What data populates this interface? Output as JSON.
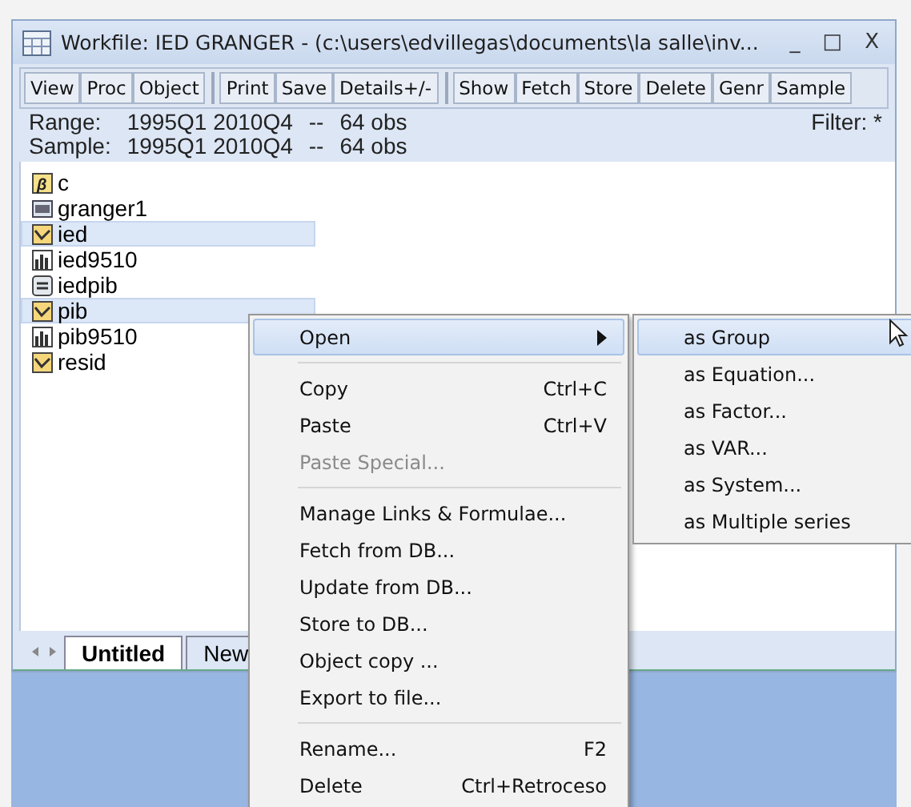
{
  "window": {
    "title": "Workfile: IED GRANGER - (c:\\users\\edvillegas\\documents\\la salle\\inv...",
    "controls": [
      "_",
      "□",
      "X"
    ]
  },
  "toolbar": [
    [
      "View",
      "Proc",
      "Object"
    ],
    [
      "Print",
      "Save",
      "Details+/-"
    ],
    [
      "Show",
      "Fetch",
      "Store",
      "Delete",
      "Genr",
      "Sample"
    ]
  ],
  "info": {
    "range_label": "Range:",
    "range": "1995Q1 2010Q4",
    "range_sep": "--",
    "range_obs": "64 obs",
    "sample_label": "Sample:",
    "sample": "1995Q1 2010Q4",
    "sample_sep": "--",
    "sample_obs": "64 obs",
    "filter": "Filter: *"
  },
  "objects": [
    {
      "name": "c",
      "kind": "coef",
      "icon_text": "β",
      "selected": false
    },
    {
      "name": "granger1",
      "kind": "var",
      "selected": false
    },
    {
      "name": "ied",
      "kind": "series",
      "selected": true
    },
    {
      "name": "ied9510",
      "kind": "graph",
      "selected": false
    },
    {
      "name": "iedpib",
      "kind": "equation",
      "selected": false
    },
    {
      "name": "pib",
      "kind": "series",
      "selected": true
    },
    {
      "name": "pib9510",
      "kind": "graph",
      "selected": false
    },
    {
      "name": "resid",
      "kind": "series",
      "selected": false
    }
  ],
  "tabs": [
    {
      "label": "Untitled",
      "selected": true
    },
    {
      "label": "New",
      "selected": false
    }
  ],
  "context_menu": [
    [
      {
        "label": "Open",
        "kind": "submenu",
        "selected": true,
        "disabled": false
      }
    ],
    [
      {
        "label": "Copy",
        "shortcut": "Ctrl+C",
        "selected": false,
        "disabled": false
      },
      {
        "label": "Paste",
        "shortcut": "Ctrl+V",
        "selected": false,
        "disabled": false
      },
      {
        "label": "Paste Special...",
        "selected": false,
        "disabled": true
      }
    ],
    [
      {
        "label": "Manage Links & Formulae...",
        "selected": false,
        "disabled": false
      },
      {
        "label": "Fetch from DB...",
        "selected": false,
        "disabled": false
      },
      {
        "label": "Update from DB...",
        "selected": false,
        "disabled": false
      },
      {
        "label": "Store to DB...",
        "selected": false,
        "disabled": false
      },
      {
        "label": "Object copy ...",
        "selected": false,
        "disabled": false
      },
      {
        "label": "Export to file...",
        "selected": false,
        "disabled": false
      }
    ],
    [
      {
        "label": "Rename...",
        "shortcut": "F2",
        "selected": false,
        "disabled": false
      },
      {
        "label": "Delete",
        "shortcut": "Ctrl+Retroceso",
        "selected": false,
        "disabled": false
      }
    ]
  ],
  "submenu": [
    {
      "label": "as Group",
      "selected": true
    },
    {
      "label": "as Equation...",
      "selected": false
    },
    {
      "label": "as Factor...",
      "selected": false
    },
    {
      "label": "as VAR...",
      "selected": false
    },
    {
      "label": "as System...",
      "selected": false
    },
    {
      "label": "as Multiple series",
      "selected": false
    }
  ]
}
